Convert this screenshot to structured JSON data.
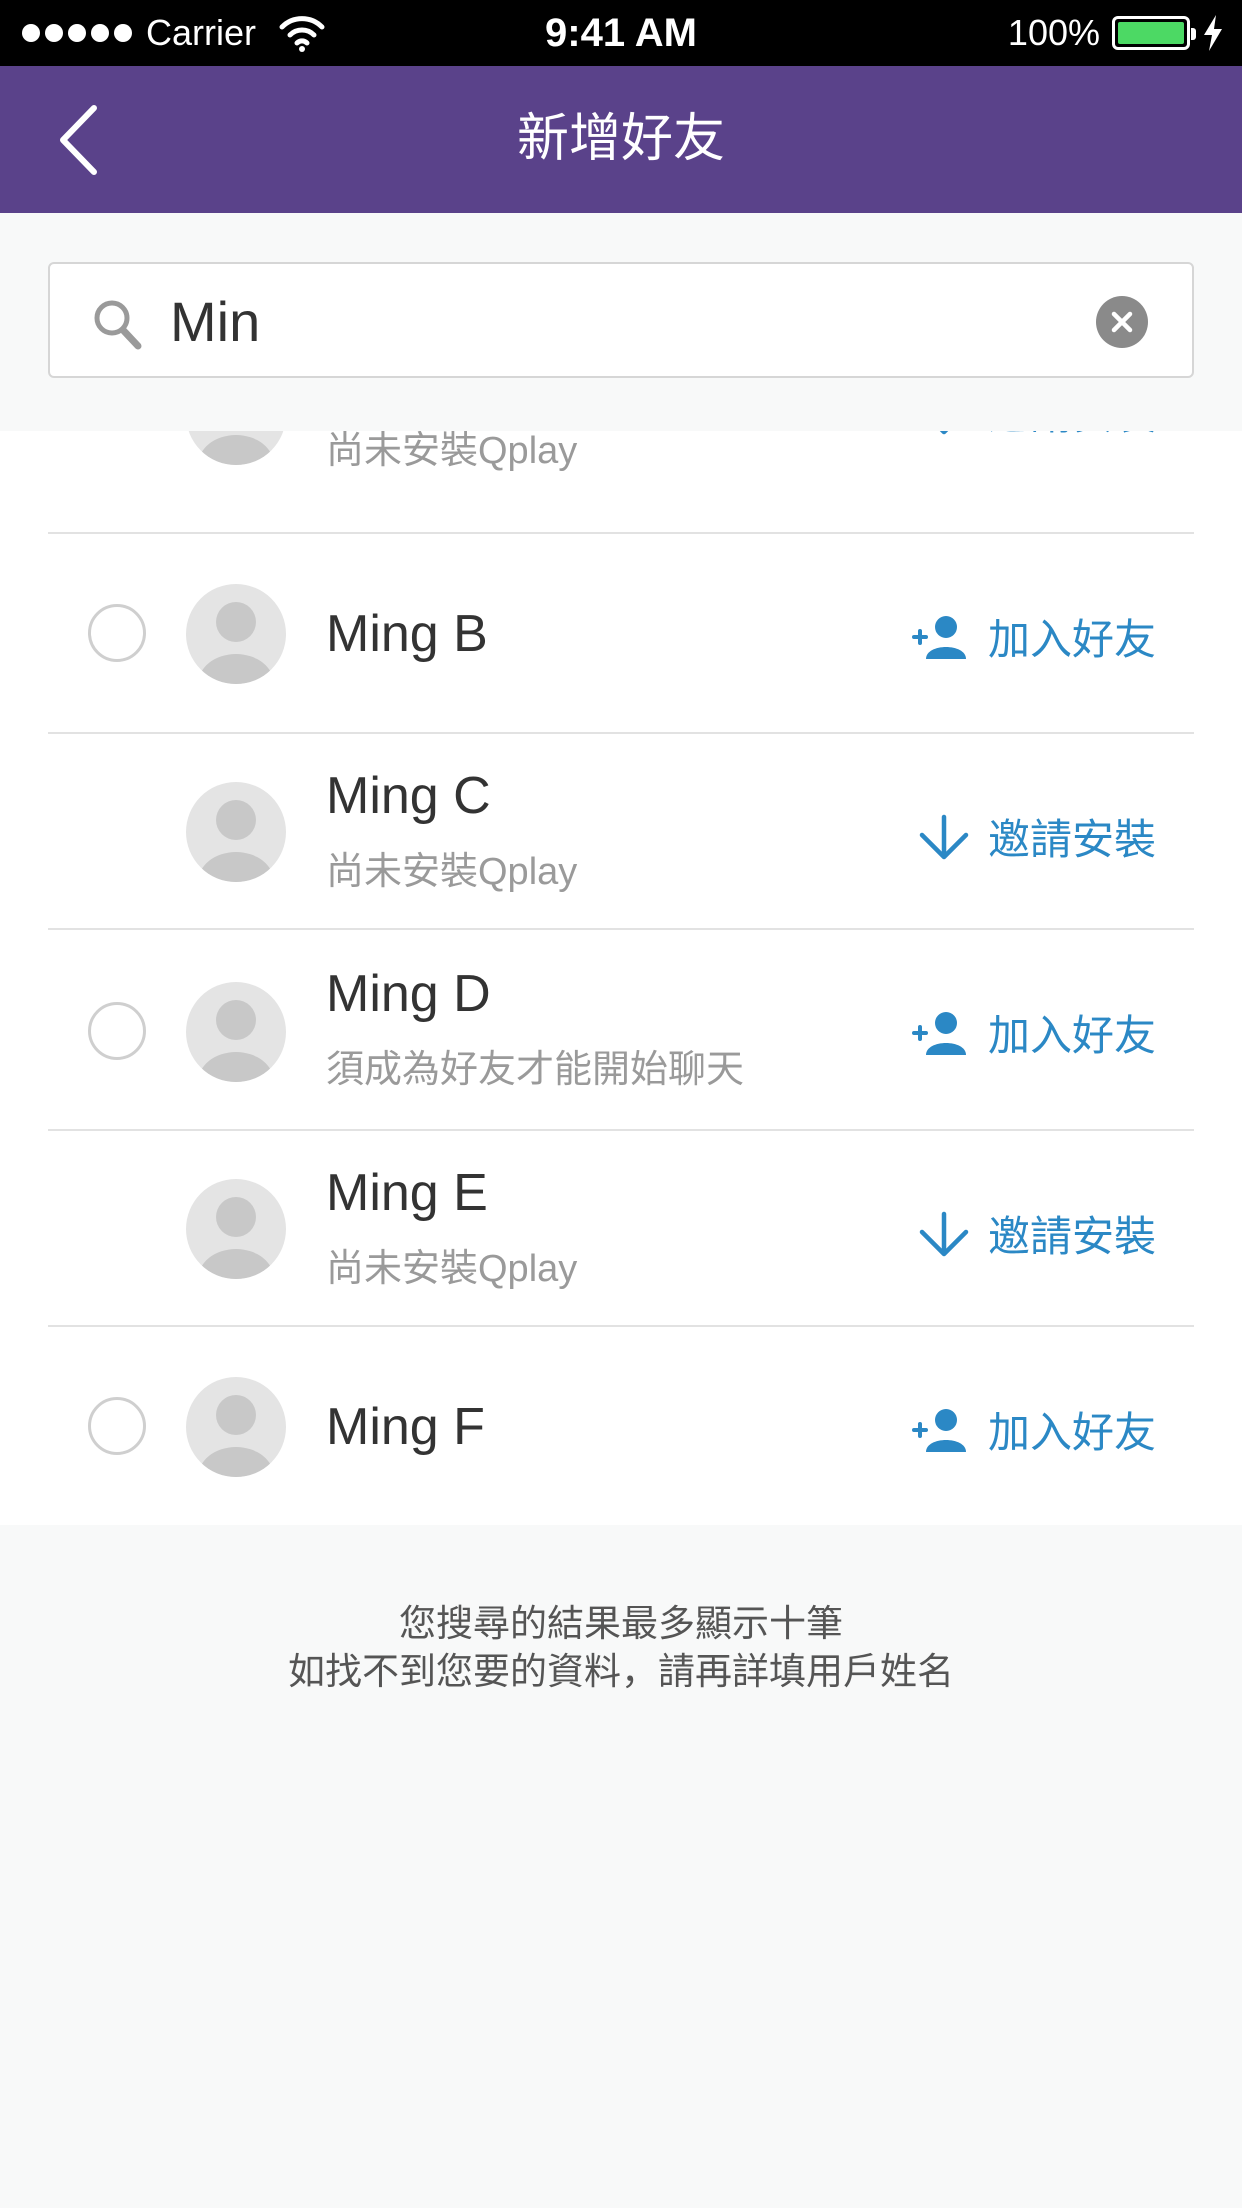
{
  "status_bar": {
    "carrier": "Carrier",
    "time": "9:41 AM",
    "battery_percent": "100%",
    "battery_level": 1.0
  },
  "nav": {
    "title": "新增好友",
    "back_icon": "chevron-left-icon"
  },
  "search": {
    "value": "Min",
    "placeholder": ""
  },
  "results": {
    "partial_row": {
      "subtitle": "尚未安裝Qplay",
      "action_label": "邀請安裝"
    },
    "rows": [
      {
        "name": "Ming B",
        "subtitle": "",
        "action_label": "加入好友",
        "action_type": "add-friend"
      },
      {
        "name": "Ming C",
        "subtitle": "尚未安裝Qplay",
        "action_label": "邀請安裝",
        "action_type": "invite-install"
      },
      {
        "name": "Ming D",
        "subtitle": "須成為好友才能開始聊天",
        "action_label": "加入好友",
        "action_type": "add-friend"
      },
      {
        "name": "Ming E",
        "subtitle": "尚未安裝Qplay",
        "action_label": "邀請安裝",
        "action_type": "invite-install"
      },
      {
        "name": "Ming F",
        "subtitle": "",
        "action_label": "加入好友",
        "action_type": "add-friend"
      }
    ]
  },
  "footer": {
    "line1": "您搜尋的結果最多顯示十筆",
    "line2": "如找不到您要的資料，請再詳填用戶姓名"
  },
  "colors": {
    "nav_background": "#5a428a",
    "action_blue": "#2b88c5",
    "page_background": "#f8f9f9"
  }
}
